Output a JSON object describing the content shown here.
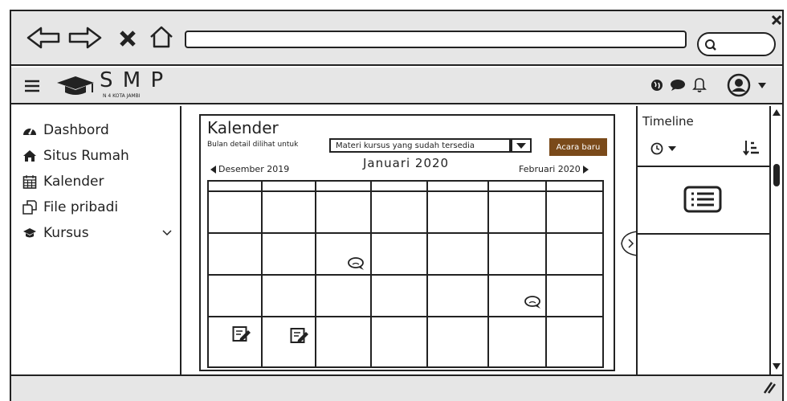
{
  "app": {
    "logo_text": "S M P",
    "logo_subtext": "N 4 KOTA JAMBI"
  },
  "sidebar": {
    "items": [
      {
        "label": "Dashbord",
        "icon": "dashboard-icon"
      },
      {
        "label": "Situs Rumah",
        "icon": "home-icon"
      },
      {
        "label": "Kalender",
        "icon": "calendar-icon"
      },
      {
        "label": "File pribadi",
        "icon": "files-icon"
      },
      {
        "label": "Kursus",
        "icon": "graduation-cap-icon"
      }
    ]
  },
  "calendar": {
    "title": "Kalender",
    "detail_label": "Bulan detail dilihat untuk",
    "select_value": "Materi kursus yang sudah tersedia",
    "new_event_label": "Acara baru",
    "prev_month": "Desember 2019",
    "current_month": "Januari 2020",
    "next_month": "Februari 2020"
  },
  "timeline": {
    "title": "Timeline"
  },
  "colors": {
    "chrome_bg": "#e6e6e6",
    "accent_button": "#7a4a1a"
  }
}
